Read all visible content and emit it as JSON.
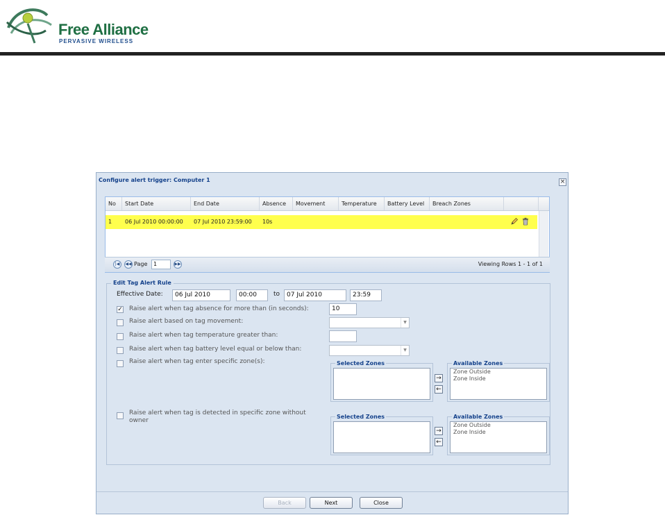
{
  "brand": {
    "name": "Free Alliance",
    "tagline": "PERVASIVE WIRELESS"
  },
  "dialog": {
    "title": "Configure alert trigger: Computer 1",
    "close_glyph": "×"
  },
  "grid": {
    "columns": [
      "No",
      "Start Date",
      "End Date",
      "Absence",
      "Movement",
      "Temperature",
      "Battery Level",
      "Breach Zones"
    ],
    "rows": [
      {
        "no": "1",
        "start_date": "06 Jul 2010 00:00:00",
        "end_date": "07 Jul 2010 23:59:00",
        "absence": "10s",
        "movement": "",
        "temperature": "",
        "battery_level": "",
        "breach_zones": "",
        "highlight_color": "#ffff4d",
        "actions": [
          "pencil-icon",
          "trash-icon"
        ]
      }
    ]
  },
  "pager": {
    "page_label": "Page",
    "page_value": "1",
    "info": "Viewing Rows 1 - 1 of 1"
  },
  "edit": {
    "legend": "Edit Tag Alert Rule",
    "effective_label": "Effective Date:",
    "start_date": "06 Jul 2010",
    "start_time": "00:00",
    "to_label": "to",
    "end_date": "07 Jul 2010",
    "end_time": "23:59",
    "rules": {
      "absence": {
        "label": "Raise alert when tag absence for more than (in seconds):",
        "checked": true,
        "check_glyph": "✓",
        "value": "10"
      },
      "movement": {
        "label": "Raise alert based on tag movement:",
        "checked": false,
        "value": ""
      },
      "temperature": {
        "label": "Raise alert when tag temperature greater than:",
        "checked": false,
        "value": ""
      },
      "battery": {
        "label": "Raise alert when tag battery level equal or below than:",
        "checked": false,
        "value": ""
      },
      "zones": {
        "label": "Raise alert when tag enter specific zone(s):",
        "checked": false
      },
      "no_owner": {
        "label_line1": "Raise alert when tag is detected in specific zone without",
        "label_line2": "owner",
        "checked": false
      }
    },
    "zone_panels": {
      "selected_title": "Selected Zones",
      "available_title": "Available Zones",
      "available_items": [
        "Zone Outside",
        "Zone Inside"
      ],
      "move_right_glyph": "→",
      "move_left_glyph": "←"
    }
  },
  "footer": {
    "back": "Back",
    "next": "Next",
    "close": "Close"
  }
}
